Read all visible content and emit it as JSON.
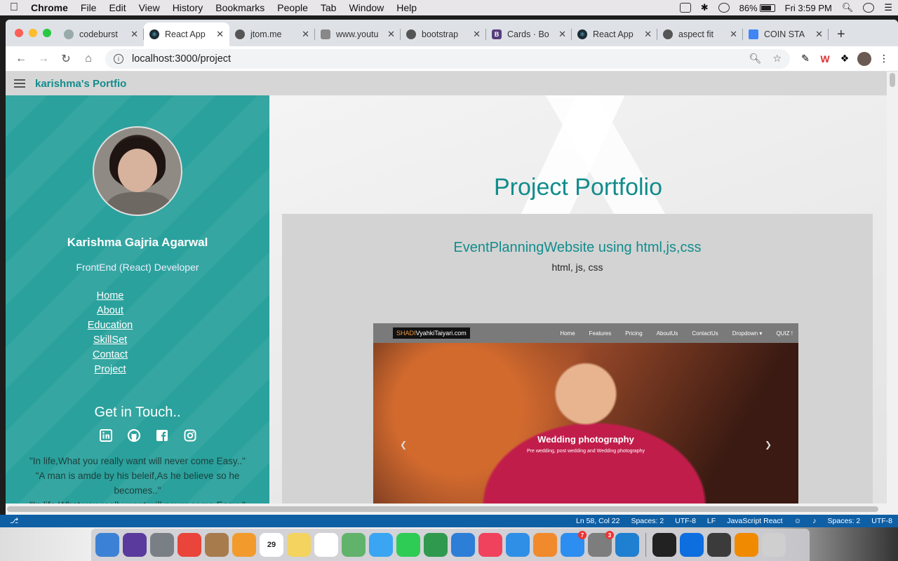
{
  "menubar": {
    "app": "Chrome",
    "items": [
      "File",
      "Edit",
      "View",
      "History",
      "Bookmarks",
      "People",
      "Tab",
      "Window",
      "Help"
    ],
    "battery": "86%",
    "clock": "Fri 3:59 PM"
  },
  "tabs": [
    {
      "title": "codeburst",
      "fav": "#9aa"
    },
    {
      "title": "React App",
      "fav": "#1e2b33"
    },
    {
      "title": "jtom.me",
      "fav": "#555"
    },
    {
      "title": "www.youtu",
      "fav": "#888"
    },
    {
      "title": "bootstrap",
      "fav": "#555"
    },
    {
      "title": "Cards · Bo",
      "fav": "#563d7c"
    },
    {
      "title": "React App",
      "fav": "#1e2b33"
    },
    {
      "title": "aspect fit",
      "fav": "#555"
    },
    {
      "title": "COIN STA",
      "fav": "#4285f4"
    }
  ],
  "address": {
    "url": "localhost:3000/project"
  },
  "app": {
    "brand": "karishma's Portfio"
  },
  "profile": {
    "name": "Karishma Gajria Agarwal",
    "role": "FrontEnd (React) Developer",
    "nav": [
      "Home",
      "About",
      "Education",
      "SkillSet",
      "Contact",
      "Project"
    ],
    "touch_title": "Get in Touch..",
    "social": [
      "linkedin-icon",
      "github-icon",
      "facebook-icon",
      "instagram-icon"
    ],
    "quote1": "\"In life,What you really want will never come Easy..\"",
    "quote2": "\"A man is amde by his beleif,As he believe so he becomes..\"",
    "quote3": "\"In life,What you really want will never come Easy..\""
  },
  "portfolio": {
    "title": "Project Portfolio",
    "project_title": "EventPlanningWebsite using html,js,css",
    "project_tech": "html, js, css",
    "preview": {
      "logo_a": "SHADI",
      "logo_b": "VyahkiTaiyari.com",
      "nav": [
        "Home",
        "Features",
        "Pricing",
        "AboutUs",
        "ContactUs",
        "Dropdown ▾",
        "QUIZ !"
      ],
      "hero_title": "Wedding photography",
      "hero_sub": "Pre wedding, post wedding and Wedding photography"
    }
  },
  "statusbar": {
    "items": [
      "Ln 58, Col 22",
      "Spaces: 2",
      "UTF-8",
      "LF",
      "JavaScript React",
      "Spaces: 2",
      "UTF-8"
    ]
  },
  "dock": [
    {
      "name": "finder-icon",
      "color": "#3b82d6"
    },
    {
      "name": "siri-icon",
      "color": "#5a3b9d"
    },
    {
      "name": "launchpad-icon",
      "color": "#7a7f86"
    },
    {
      "name": "chrome-icon",
      "color": "#e9453a"
    },
    {
      "name": "contacts-icon",
      "color": "#a77b4c"
    },
    {
      "name": "photos-icon",
      "color": "#f29b2c"
    },
    {
      "name": "calendar-icon",
      "color": "#ffffff",
      "label": "29"
    },
    {
      "name": "notes-icon",
      "color": "#f4d35e"
    },
    {
      "name": "reminders-icon",
      "color": "#ffffff"
    },
    {
      "name": "maps-icon",
      "color": "#61b36b"
    },
    {
      "name": "messages-icon",
      "color": "#3aa5f2"
    },
    {
      "name": "facetime-icon",
      "color": "#2ecc55"
    },
    {
      "name": "numbers-icon",
      "color": "#2f9a4e"
    },
    {
      "name": "keynote-icon",
      "color": "#2d7ed6"
    },
    {
      "name": "music-icon",
      "color": "#f0425d"
    },
    {
      "name": "safari-icon",
      "color": "#2f8fe6"
    },
    {
      "name": "books-icon",
      "color": "#f08a2c"
    },
    {
      "name": "appstore-icon",
      "color": "#2b8ef0",
      "badge": "7"
    },
    {
      "name": "settings-icon",
      "color": "#7d7d7d",
      "badge": "3"
    },
    {
      "name": "vscode-icon",
      "color": "#1f7fd1"
    },
    {
      "name": "terminal-icon",
      "color": "#222222"
    },
    {
      "name": "teamviewer-icon",
      "color": "#0d6ee0"
    },
    {
      "name": "sublime-icon",
      "color": "#3b3b3b"
    },
    {
      "name": "vlc-icon",
      "color": "#f08a00"
    },
    {
      "name": "trash-icon",
      "color": "#cfcfcf"
    }
  ]
}
